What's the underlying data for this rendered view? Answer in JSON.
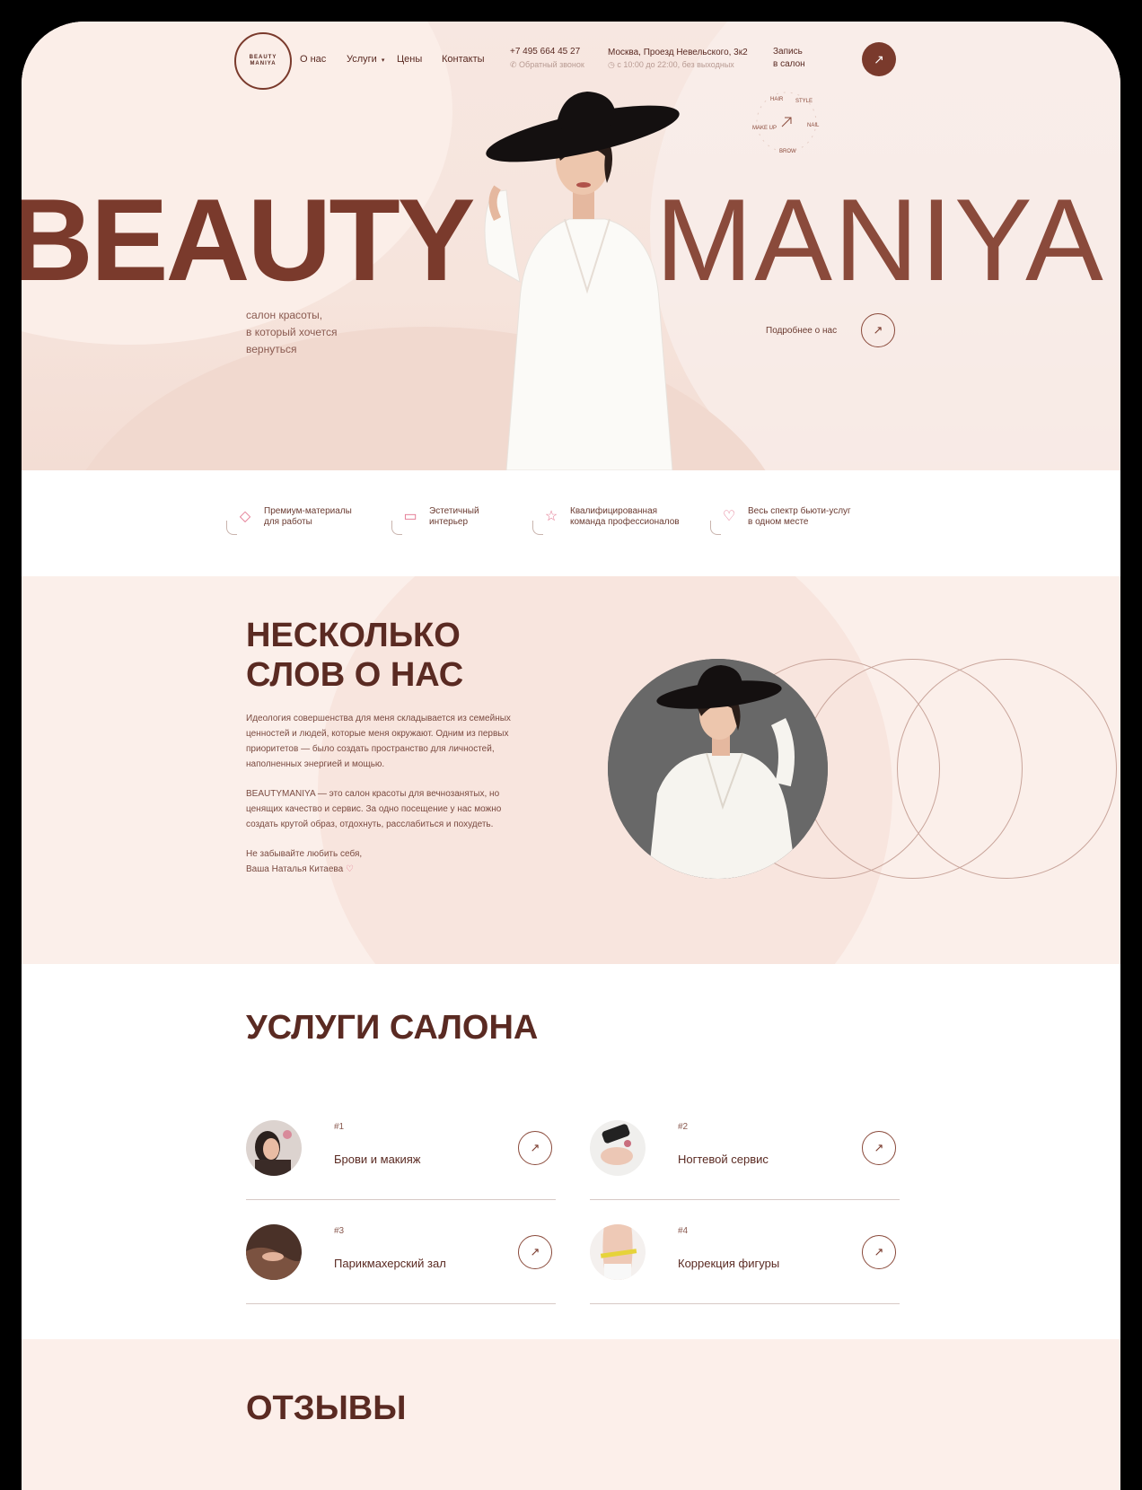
{
  "logo": {
    "line1": "BEAUTY",
    "line2": "MANIYA"
  },
  "nav": [
    {
      "label": "О нас"
    },
    {
      "label": "Услуги",
      "caret": "▾"
    },
    {
      "label": "Цены"
    },
    {
      "label": "Контакты"
    }
  ],
  "contacts": {
    "phone": "+7 495 664 45 27",
    "callback": "Обратный звонок",
    "address": "Москва, Проезд Невельского, 3к2",
    "hours": "с 10:00 до 22:00, без выходных",
    "booking_line1": "Запись",
    "booking_line2": "в салон",
    "arrow": "↗"
  },
  "hero": {
    "word_bold": "BEAUTY",
    "word_thin": "MANIYA",
    "tagline": [
      "салон красоты,",
      "в который хочется",
      "вернуться"
    ],
    "more_label": "Подробнее о нас",
    "badge_words": [
      "HAIR",
      "STYLE",
      "NAIL",
      "BROW",
      "MAKE UP"
    ]
  },
  "features": [
    {
      "icon": "diamond-icon",
      "text": "Премиум-материалы\nдля работы"
    },
    {
      "icon": "sofa-icon",
      "text": "Эстетичный\nинтерьер"
    },
    {
      "icon": "star-icon",
      "text": "Квалифицированная\nкоманда профессионалов"
    },
    {
      "icon": "heart-icon",
      "text": "Весь спектр бьюти-услуг\nв одном месте"
    }
  ],
  "about": {
    "title_line1": "НЕСКОЛЬКО",
    "title_line2": "СЛОВ О НАС",
    "para1": "Идеология совершенства для меня складывается из семейных ценностей и людей, которые меня окружают. Одним из первых приоритетов — было создать пространство для личностей, наполненных энергией и мощью.",
    "para2": "BEAUTYMANIYA — это салон красоты для вечнозанятых, но ценящих качество и сервис. За одно посещение у нас можно создать крутой образ, отдохнуть, расслабиться и похудеть.",
    "sign1": "Не забывайте любить себя,",
    "sign2": "Ваша Наталья Китаева"
  },
  "services": {
    "title": "УСЛУГИ САЛОНА",
    "items": [
      {
        "num": "#1",
        "name": "Брови и макияж"
      },
      {
        "num": "#2",
        "name": "Ногтевой сервис"
      },
      {
        "num": "#3",
        "name": "Парикмахерский зал"
      },
      {
        "num": "#4",
        "name": "Коррекция фигуры"
      }
    ]
  },
  "reviews": {
    "title": "ОТЗЫВЫ"
  },
  "colors": {
    "brand": "#7a3a2c",
    "accent_pink": "#e2738d",
    "hero_bg": "#f6e4dc"
  }
}
